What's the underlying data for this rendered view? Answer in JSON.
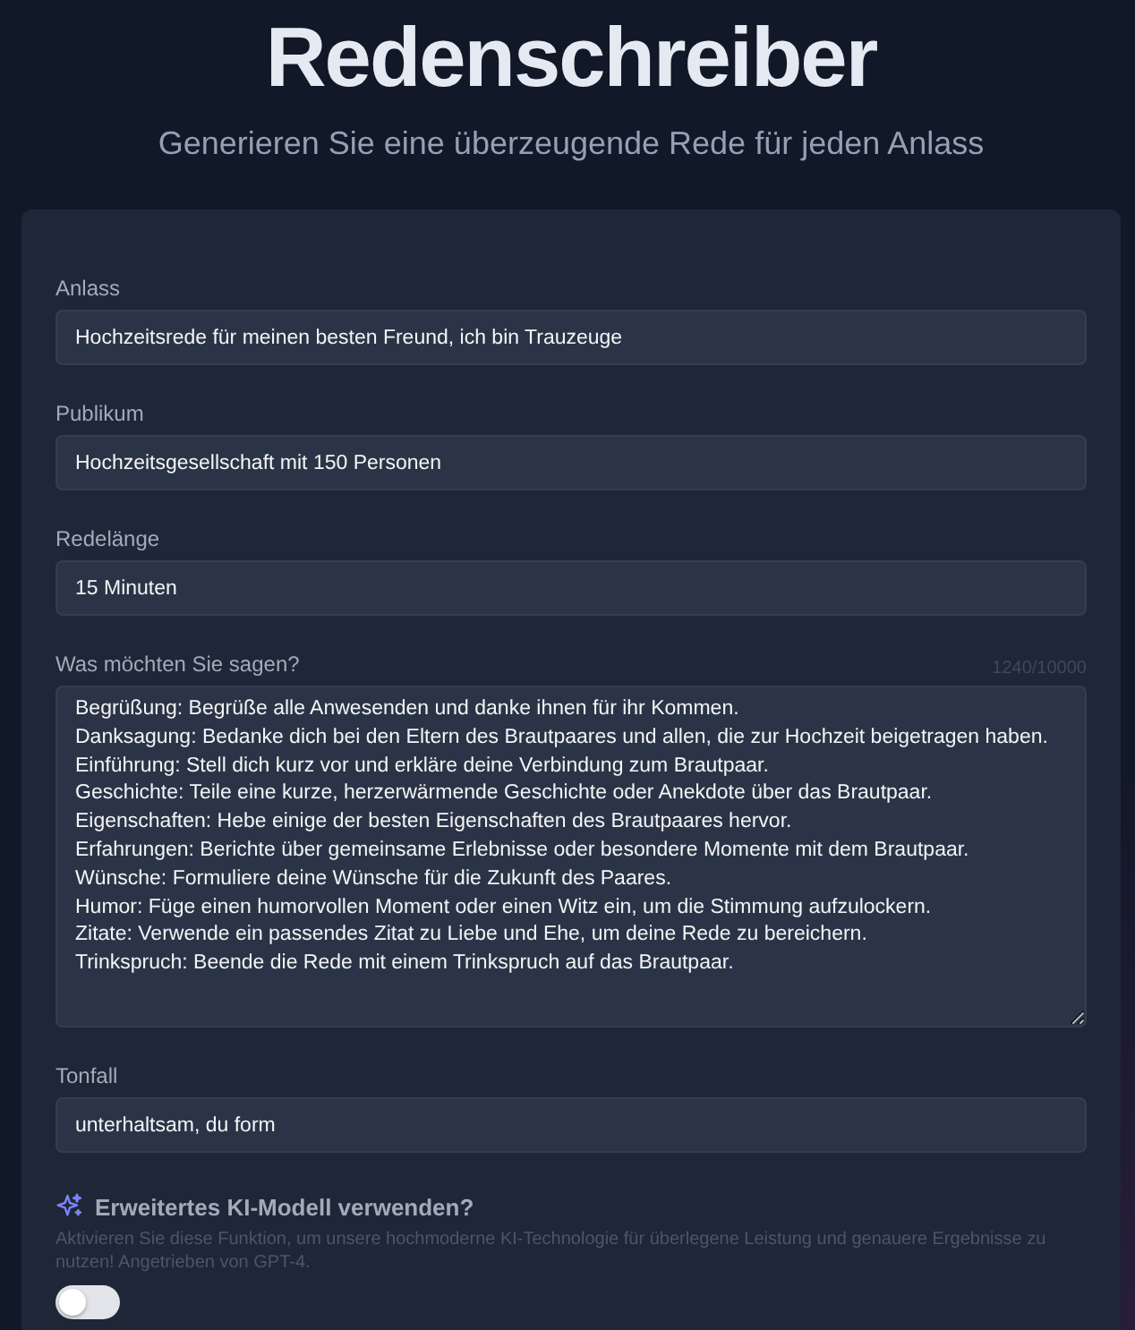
{
  "header": {
    "title": "Redenschreiber",
    "subtitle": "Generieren Sie eine überzeugende Rede für jeden Anlass"
  },
  "fields": [
    {
      "kind": "input",
      "label": "Anlass",
      "value": "Hochzeitsrede für meinen besten Freund, ich bin Trauzeuge"
    },
    {
      "kind": "input",
      "label": "Publikum",
      "value": "Hochzeitsgesellschaft mit 150 Personen"
    },
    {
      "kind": "input",
      "label": "Redelänge",
      "value": "15 Minuten"
    },
    {
      "kind": "textarea",
      "label": "Was möchten Sie sagen?",
      "counter": "1240/10000",
      "value": "Begrüßung: Begrüße alle Anwesenden und danke ihnen für ihr Kommen.\nDanksagung: Bedanke dich bei den Eltern des Brautpaares und allen, die zur Hochzeit beigetragen haben.\nEinführung: Stell dich kurz vor und erkläre deine Verbindung zum Brautpaar.\nGeschichte: Teile eine kurze, herzerwärmende Geschichte oder Anekdote über das Brautpaar.\nEigenschaften: Hebe einige der besten Eigenschaften des Brautpaares hervor.\nErfahrungen: Berichte über gemeinsame Erlebnisse oder besondere Momente mit dem Brautpaar.\nWünsche: Formuliere deine Wünsche für die Zukunft des Paares.\nHumor: Füge einen humorvollen Moment oder einen Witz ein, um die Stimmung aufzulockern.\nZitate: Verwende ein passendes Zitat zu Liebe und Ehe, um deine Rede zu bereichern.\nTrinkspruch: Beende die Rede mit einem Trinkspruch auf das Brautpaar."
    },
    {
      "kind": "input",
      "label": "Tonfall",
      "value": "unterhaltsam, du form"
    }
  ],
  "advanced_model": {
    "title": "Erweitertes KI-Modell verwenden?",
    "description": "Aktivieren Sie diese Funktion, um unsere hochmoderne KI-Technologie für überlegene Leistung und genauere Ergebnisse zu nutzen! Angetrieben von GPT-4.",
    "on": false
  }
}
